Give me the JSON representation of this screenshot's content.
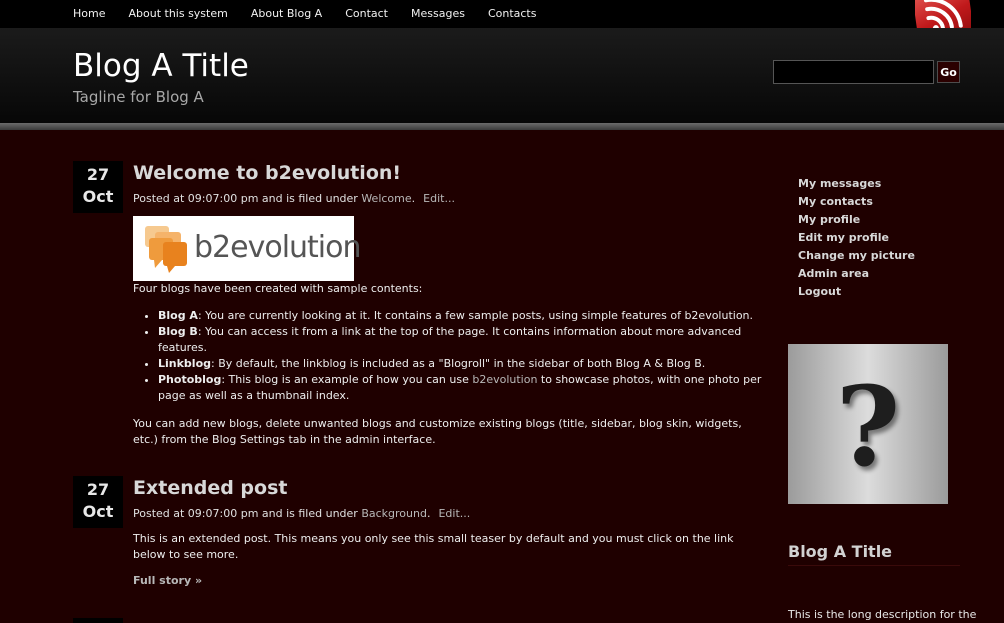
{
  "nav": {
    "items": [
      {
        "label": "Home"
      },
      {
        "label": "About this system"
      },
      {
        "label": "About Blog A"
      },
      {
        "label": "Contact"
      },
      {
        "label": "Messages"
      },
      {
        "label": "Contacts"
      }
    ]
  },
  "header": {
    "title": "Blog A Title",
    "tagline": "Tagline for Blog A",
    "search_value": "",
    "search_button": "Go"
  },
  "posts": [
    {
      "day": "27",
      "month": "Oct",
      "title": "Welcome to b2evolution!",
      "meta_prefix": "Posted at 09:07:00 pm and is filed under ",
      "category": "Welcome",
      "meta_suffix": ".",
      "edit": "Edit...",
      "logo_text": "b2evolution",
      "intro": "Four blogs have been created with sample contents:",
      "bullets": [
        {
          "name": "Blog A",
          "text": ": You are currently looking at it. It contains a few sample posts, using simple features of b2evolution."
        },
        {
          "name": "Blog B",
          "text": ": You can access it from a link at the top of the page. It contains information about more advanced features."
        },
        {
          "name": "Linkblog",
          "text": ": By default, the linkblog is included as a \"Blogroll\" in the sidebar of both Blog A & Blog B."
        },
        {
          "name": "Photoblog",
          "text_before": ": This blog is an example of how you can use ",
          "link": "b2evolution",
          "text_after": " to showcase photos, with one photo per page as well as a thumbnail index."
        }
      ],
      "outro": "You can add new blogs, delete unwanted blogs and customize existing blogs (title, sidebar, blog skin, widgets, etc.) from the Blog Settings tab in the admin interface."
    },
    {
      "day": "27",
      "month": "Oct",
      "title": "Extended post",
      "meta_prefix": "Posted at 09:07:00 pm and is filed under ",
      "category": "Background",
      "meta_suffix": ".",
      "edit": "Edit...",
      "teaser": "This is an extended post. This means you only see this small teaser by default and you must click on the link below to see more.",
      "full_story": "Full story »"
    }
  ],
  "sidebar": {
    "links": [
      {
        "label": "My messages"
      },
      {
        "label": "My contacts"
      },
      {
        "label": "My profile"
      },
      {
        "label": "Edit my profile"
      },
      {
        "label": "Change my picture"
      },
      {
        "label": "Admin area"
      },
      {
        "label": "Logout"
      }
    ],
    "avatar_glyph": "?",
    "blog_title": "Blog A Title",
    "blog_description": "This is the long description for the"
  },
  "icons": {
    "rss": "rss-feed-icon",
    "avatar": "question-mark-avatar-icon"
  },
  "colors": {
    "page_background": "#1f0000",
    "header_background": "#000000",
    "rss_red": "#c0191b"
  }
}
